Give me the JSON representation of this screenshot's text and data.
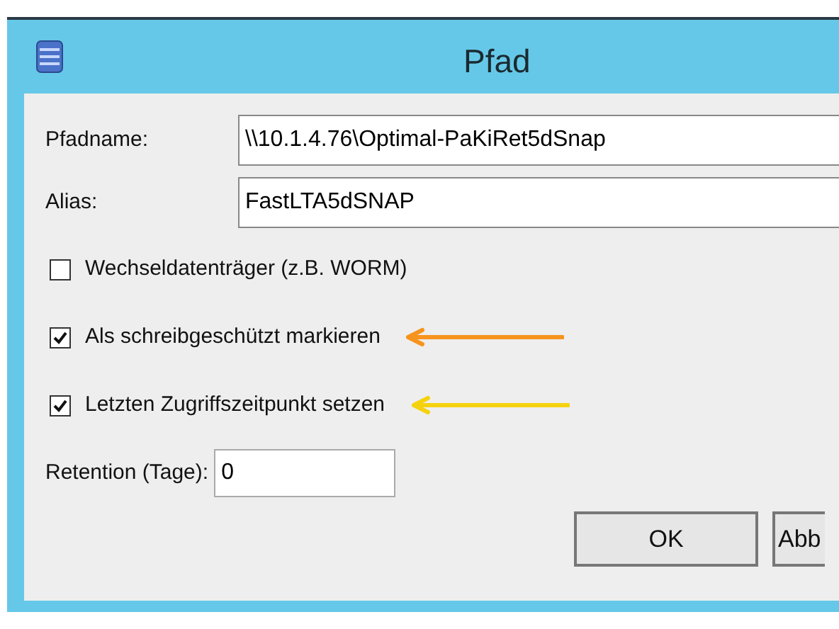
{
  "window": {
    "title": "Pfad"
  },
  "fields": [
    {
      "label": "Pfadname:",
      "value": "\\\\10.1.4.76\\Optimal-PaKiRet5dSnap"
    },
    {
      "label": "Alias:",
      "value": "FastLTA5dSNAP"
    }
  ],
  "checkboxes": [
    {
      "label": "Wechseldatenträger (z.B. WORM)",
      "checked": false
    },
    {
      "label": "Als schreibgeschützt markieren",
      "checked": true,
      "arrow": {
        "color": "#f7941d"
      }
    },
    {
      "label": "Letzten Zugriffszeitpunkt setzen",
      "checked": true,
      "arrow": {
        "color": "#f5d20f"
      }
    }
  ],
  "retention": {
    "label": "Retention (Tage):",
    "value": "0"
  },
  "buttons": [
    {
      "label": "OK"
    },
    {
      "label": "Abb"
    }
  ]
}
